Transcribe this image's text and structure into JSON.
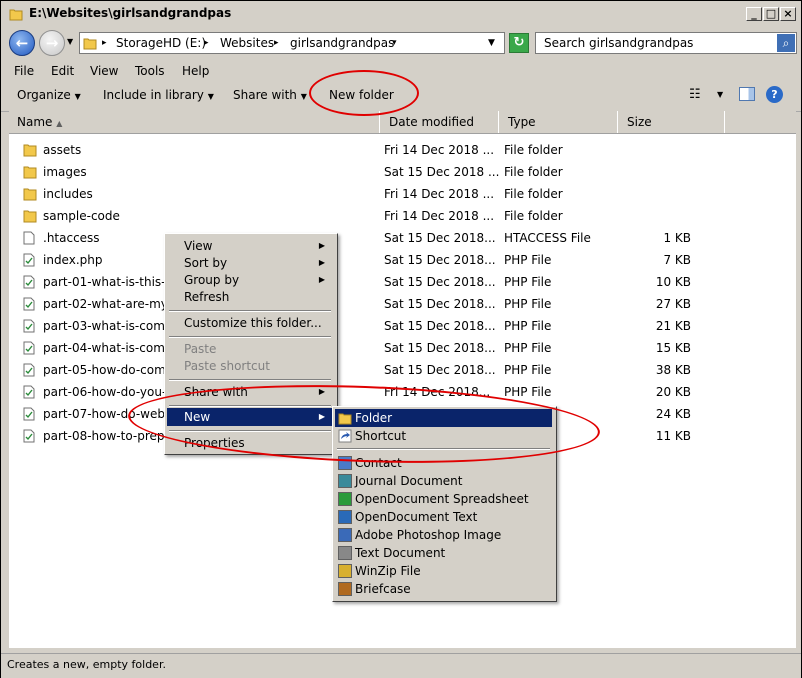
{
  "window": {
    "title": "E:\\Websites\\girlsandgrandpas"
  },
  "address": {
    "segments": [
      "StorageHD (E:)",
      "Websites",
      "girlsandgrandpas"
    ]
  },
  "search": {
    "placeholder": "Search girlsandgrandpas"
  },
  "menu": [
    "File",
    "Edit",
    "View",
    "Tools",
    "Help"
  ],
  "toolbar": {
    "organize": "Organize",
    "include_library": "Include in library",
    "share_with": "Share with",
    "new_folder": "New folder"
  },
  "columns": {
    "name": "Name",
    "date": "Date modified",
    "type": "Type",
    "size": "Size"
  },
  "files": [
    {
      "name": "assets",
      "date": "Fri 14 Dec 2018 ...",
      "type": "File folder",
      "size": "",
      "icon": "folder-icon"
    },
    {
      "name": "images",
      "date": "Sat 15 Dec 2018 ...",
      "type": "File folder",
      "size": "",
      "icon": "folder-icon"
    },
    {
      "name": "includes",
      "date": "Fri 14 Dec 2018 ...",
      "type": "File folder",
      "size": "",
      "icon": "folder-icon"
    },
    {
      "name": "sample-code",
      "date": "Fri 14 Dec 2018 ...",
      "type": "File folder",
      "size": "",
      "icon": "folder-icon"
    },
    {
      "name": ".htaccess",
      "date": "Sat 15 Dec 2018...",
      "type": "HTACCESS File",
      "size": "1 KB",
      "icon": "file-icon"
    },
    {
      "name": "index.php",
      "date": "Sat 15 Dec 2018...",
      "type": "PHP File",
      "size": "7 KB",
      "icon": "php-file-icon"
    },
    {
      "name": "part-01-what-is-this-w",
      "date": "Sat 15 Dec 2018...",
      "type": "PHP File",
      "size": "10 KB",
      "icon": "php-file-icon"
    },
    {
      "name": "part-02-what-are-my-c",
      "date": "Sat 15 Dec 2018...",
      "type": "PHP File",
      "size": "27 KB",
      "icon": "php-file-icon"
    },
    {
      "name": "part-03-what-is-compu",
      "date": "Sat 15 Dec 2018...",
      "type": "PHP File",
      "size": "21 KB",
      "icon": "php-file-icon"
    },
    {
      "name": "part-04-what-is-compu",
      "date": "Sat 15 Dec 2018...",
      "type": "PHP File",
      "size": "15 KB",
      "icon": "php-file-icon"
    },
    {
      "name": "part-05-how-do-compu",
      "date": "Sat 15 Dec 2018...",
      "type": "PHP File",
      "size": "38 KB",
      "icon": "php-file-icon"
    },
    {
      "name": "part-06-how-do-you-g",
      "date": "Fri 14 Dec 2018...",
      "type": "PHP File",
      "size": "20 KB",
      "icon": "php-file-icon"
    },
    {
      "name": "part-07-how-do-websi",
      "date": "",
      "type": "",
      "size": "24 KB",
      "icon": "php-file-icon"
    },
    {
      "name": "part-08-how-to-prepar",
      "date": "",
      "type": "",
      "size": "11 KB",
      "icon": "php-file-icon"
    }
  ],
  "context_menu": {
    "view": "View",
    "sort_by": "Sort by",
    "group_by": "Group by",
    "refresh": "Refresh",
    "customize": "Customize this folder...",
    "paste": "Paste",
    "paste_shortcut": "Paste shortcut",
    "share_with": "Share with",
    "new": "New",
    "properties": "Properties"
  },
  "new_submenu": {
    "folder": "Folder",
    "shortcut": "Shortcut",
    "items": [
      "Contact",
      "Journal Document",
      "OpenDocument Spreadsheet",
      "OpenDocument Text",
      "Adobe Photoshop Image",
      "Text Document",
      "WinZip File",
      "Briefcase"
    ]
  },
  "status": {
    "text": "Creates a new, empty folder."
  },
  "colors": {
    "highlight": "#0a246a",
    "annotation_red": "#e00000",
    "folder_yellow": "#f2c84b"
  }
}
